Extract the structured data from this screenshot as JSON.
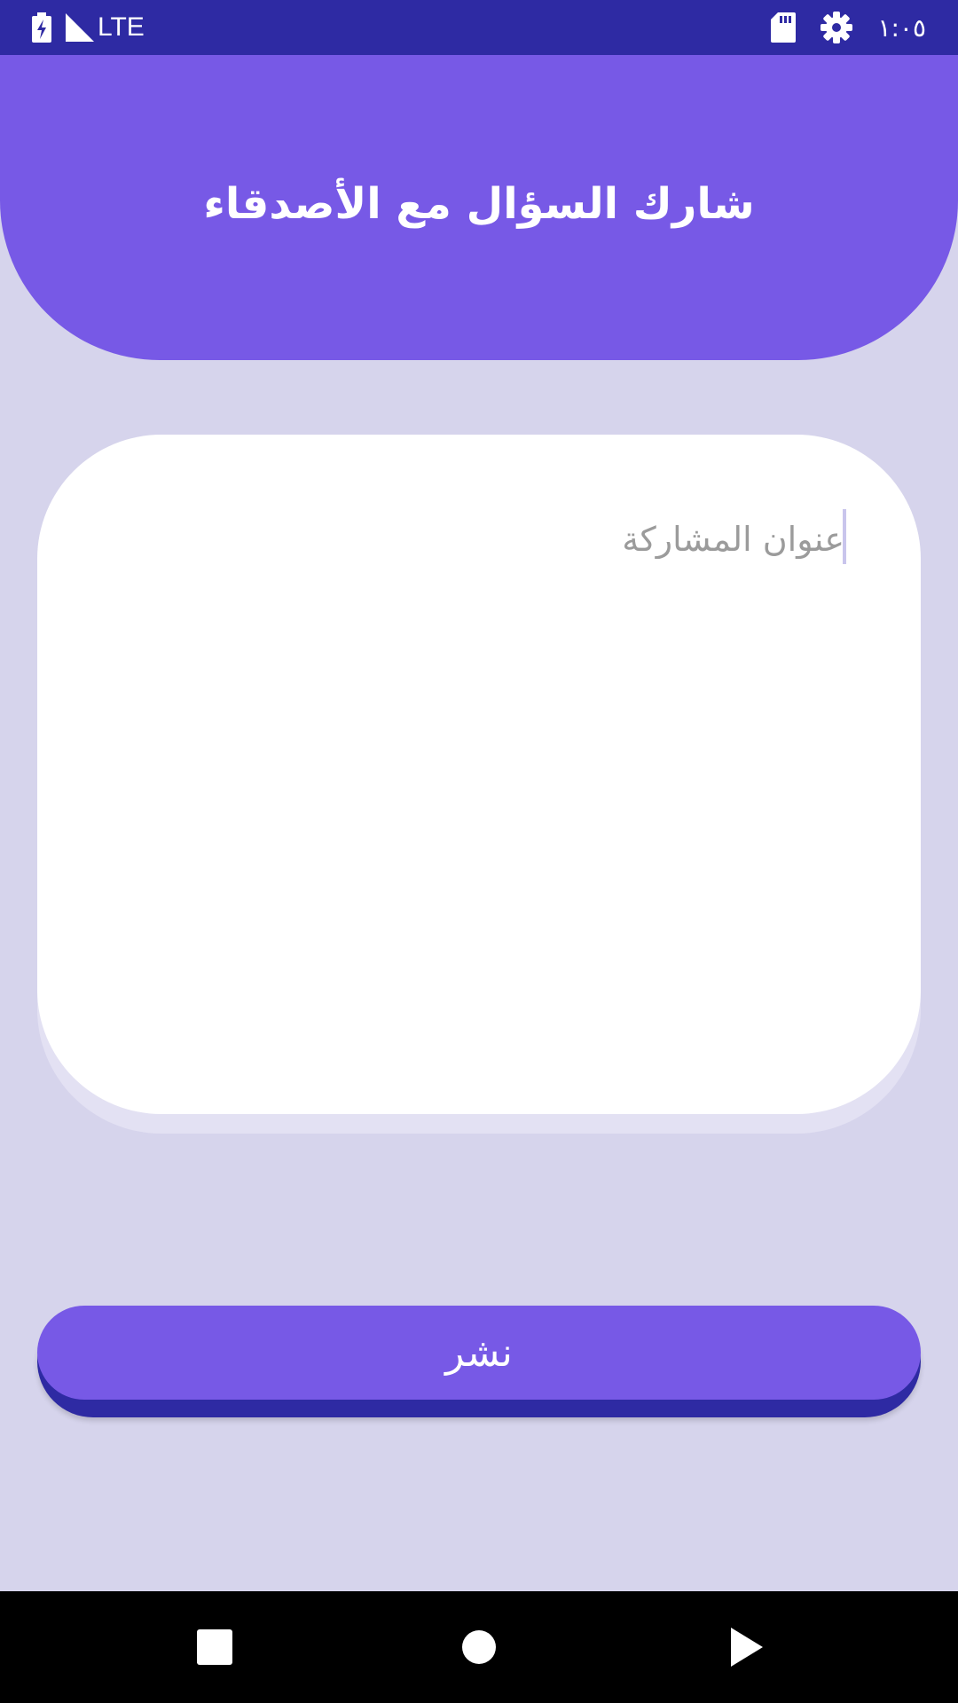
{
  "status_bar": {
    "network_label": "LTE",
    "clock": "١:٠٥",
    "icons": [
      "battery-charging-icon",
      "signal-icon",
      "sd-card-icon",
      "gear-icon"
    ]
  },
  "header": {
    "title": "شارك السؤال مع الأصدقاء"
  },
  "form": {
    "title_placeholder": "عنوان المشاركة",
    "title_value": ""
  },
  "publish_button": {
    "label": "نشر"
  },
  "nav_bar": {
    "icons": [
      "recents-icon",
      "home-icon",
      "back-icon"
    ]
  },
  "colors": {
    "status_bar": "#2e2aa3",
    "accent": "#7759e6",
    "background": "#d6d4ec",
    "card": "#ffffff",
    "nav_bar": "#000000"
  }
}
